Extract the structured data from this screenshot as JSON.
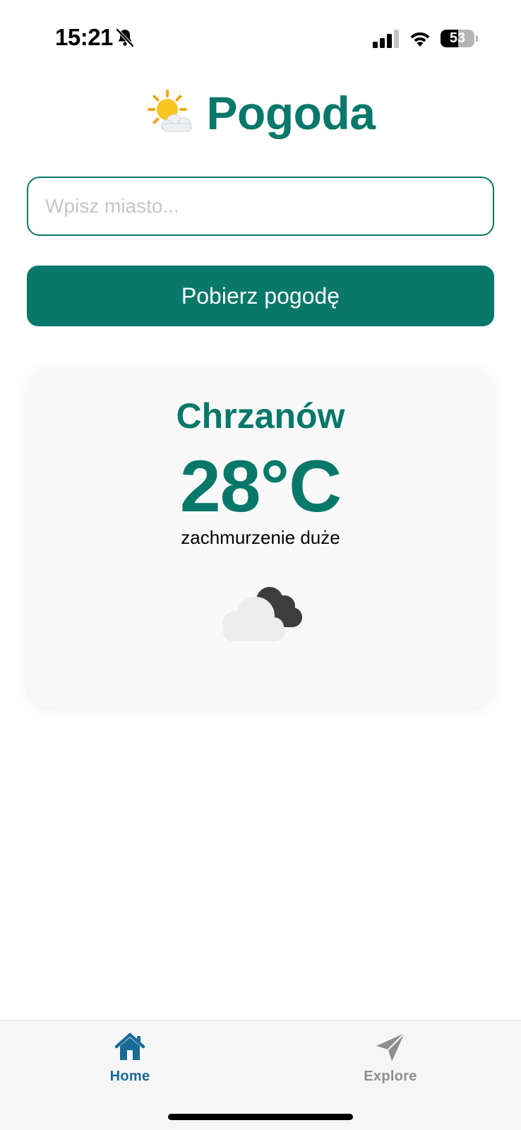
{
  "status_bar": {
    "time": "15:21",
    "battery_level": "53",
    "icons": [
      "bell-slash-icon",
      "cellular-signal-icon",
      "wifi-icon",
      "battery-icon"
    ]
  },
  "header": {
    "emoji_icon": "sun-behind-cloud-icon",
    "title": "Pogoda"
  },
  "search": {
    "placeholder": "Wpisz miasto...",
    "value": ""
  },
  "fetch_button": {
    "label": "Pobierz pogodę"
  },
  "weather": {
    "city": "Chrzanów",
    "temperature": "28°C",
    "description": "zachmurzenie duże",
    "icon": "broken-clouds-icon"
  },
  "tab_bar": {
    "tabs": [
      {
        "label": "Home",
        "icon": "home-icon",
        "active": true
      },
      {
        "label": "Explore",
        "icon": "paper-plane-icon",
        "active": false
      }
    ],
    "active_color": "#1a6b96",
    "inactive_color": "#8e8e8e"
  },
  "colors": {
    "accent": "#08786a",
    "card_background": "#f9f9f9"
  }
}
